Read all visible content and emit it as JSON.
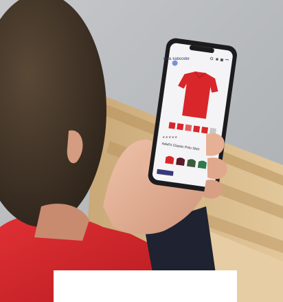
{
  "scene": {
    "colors": {
      "background_blur": "#b9bcbf",
      "wood": "#d8b98a",
      "hair": "#4a3a2c",
      "skin": "#e7b49a",
      "jersey_red": "#d8262a",
      "phone_frame": "#1c1c1e",
      "screen": "#f4f4f6",
      "white_box": "#ffffff"
    }
  },
  "phone_screen": {
    "brand": "kit & kaboodle",
    "rating": "★★★★★",
    "product_name": "Adult's Classic Polo Shirt",
    "cta": "Add to bag",
    "icons": [
      "search-icon",
      "account-icon",
      "basket-icon",
      "menu-icon",
      "back-icon"
    ],
    "color_swatches": [
      "#d8262a",
      "#5a1b28",
      "#3b5b3a",
      "#2f7a4a",
      "#c7c7c7"
    ]
  }
}
